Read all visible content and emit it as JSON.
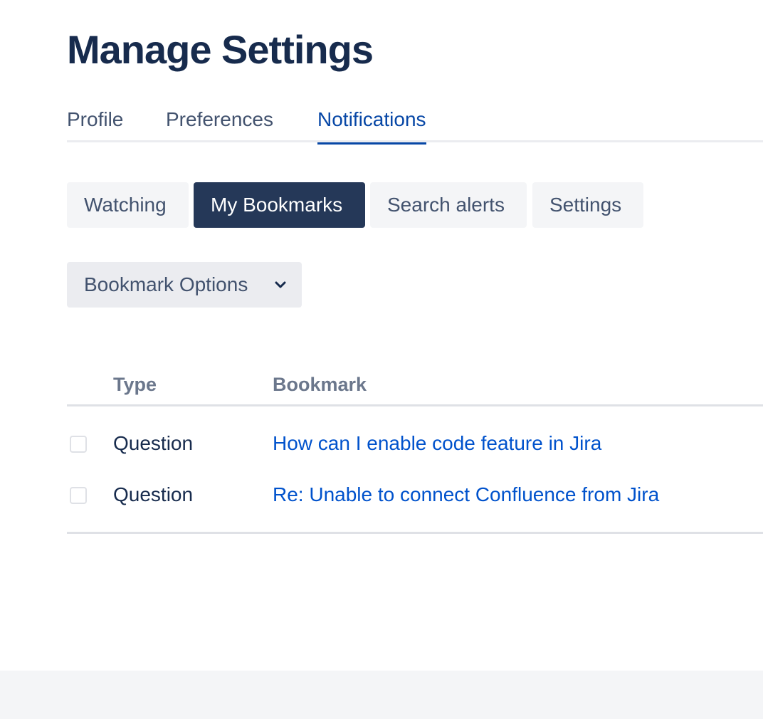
{
  "page": {
    "title": "Manage Settings"
  },
  "main_tabs": [
    {
      "label": "Profile",
      "active": false
    },
    {
      "label": "Preferences",
      "active": false
    },
    {
      "label": "Notifications",
      "active": true
    }
  ],
  "sub_tabs": [
    {
      "label": "Watching",
      "active": false
    },
    {
      "label": "My Bookmarks",
      "active": true
    },
    {
      "label": "Search alerts",
      "active": false
    },
    {
      "label": "Settings",
      "active": false
    }
  ],
  "bookmark_options": {
    "label": "Bookmark Options",
    "icon": "chevron-down-icon"
  },
  "table": {
    "columns": [
      "Type",
      "Bookmark"
    ],
    "rows": [
      {
        "type": "Question",
        "bookmark": "How can I enable code feature in Jira",
        "checked": false
      },
      {
        "type": "Question",
        "bookmark": "Re: Unable to connect Confluence from Jira",
        "checked": false
      }
    ]
  },
  "colors": {
    "title": "#172b4d",
    "active_tab": "#0747a6",
    "active_subtab_bg": "#253858",
    "link": "#0052cc",
    "footer_bg": "#f4f5f7"
  }
}
